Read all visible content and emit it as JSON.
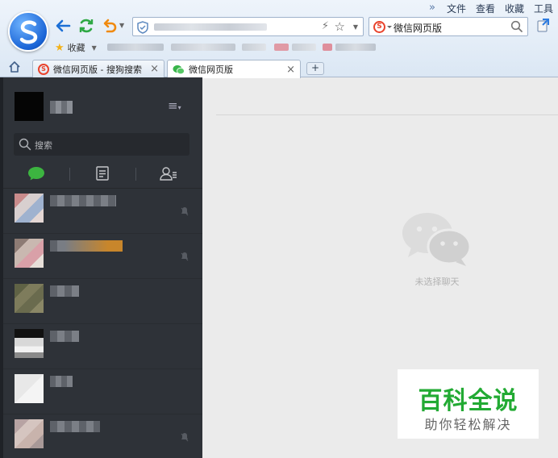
{
  "browser": {
    "menu": [
      "文件",
      "查看",
      "收藏",
      "工具"
    ],
    "more_symbol": "»",
    "search_query": "微信网页版",
    "favorites_label": "收藏",
    "tabs": [
      {
        "label": "微信网页版 - 搜狗搜索",
        "active": false
      },
      {
        "label": "微信网页版",
        "active": true
      }
    ],
    "new_tab_symbol": "+"
  },
  "wechat": {
    "search_placeholder": "搜索",
    "empty_state": "未选择聊天",
    "icons": [
      "chat-icon",
      "contacts-list-icon",
      "add-contact-icon",
      "mute-icon"
    ]
  },
  "watermark": {
    "title": "百科全说",
    "subtitle": "助你轻松解决"
  },
  "colors": {
    "sidebar": "#2e3238",
    "wechat_green": "#39b54a",
    "main_bg": "#ebebeb"
  }
}
